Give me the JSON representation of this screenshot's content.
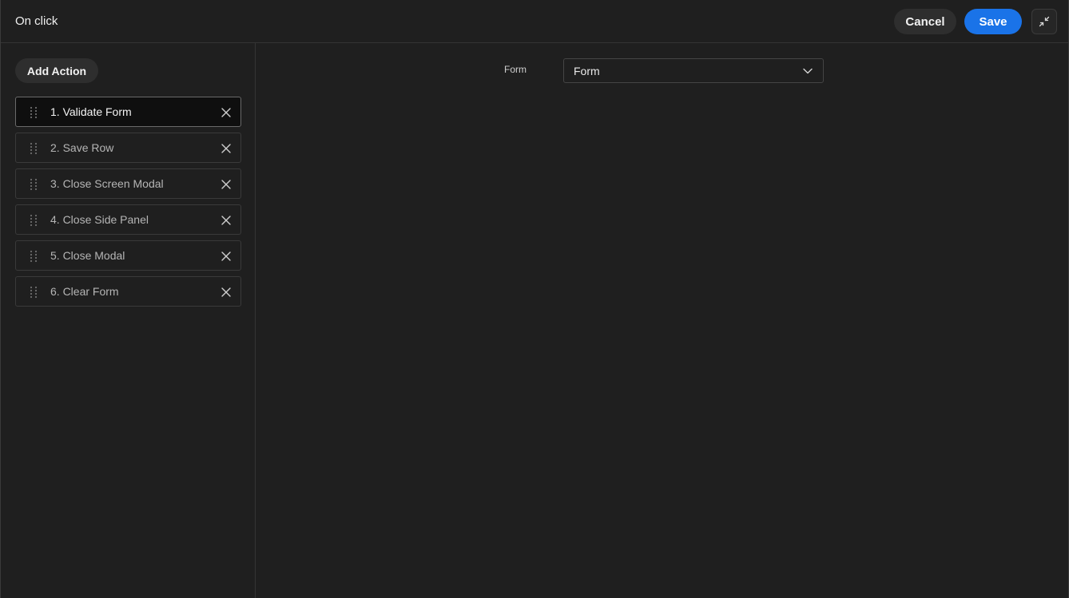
{
  "header": {
    "title": "On click",
    "cancel_label": "Cancel",
    "save_label": "Save",
    "collapse_icon": "minimize-arrows-icon"
  },
  "sidebar": {
    "add_action_label": "Add Action",
    "actions": [
      {
        "label": "1. Validate Form",
        "selected": true
      },
      {
        "label": "2. Save Row",
        "selected": false
      },
      {
        "label": "3. Close Screen Modal",
        "selected": false
      },
      {
        "label": "4. Close Side Panel",
        "selected": false
      },
      {
        "label": "5. Close Modal",
        "selected": false
      },
      {
        "label": "6. Clear Form",
        "selected": false
      }
    ]
  },
  "main": {
    "form_field": {
      "label": "Form",
      "value": "Form"
    }
  },
  "colors": {
    "background": "#1f1f1f",
    "accent": "#1a73e8",
    "selected_item": "#0f0f0f"
  }
}
